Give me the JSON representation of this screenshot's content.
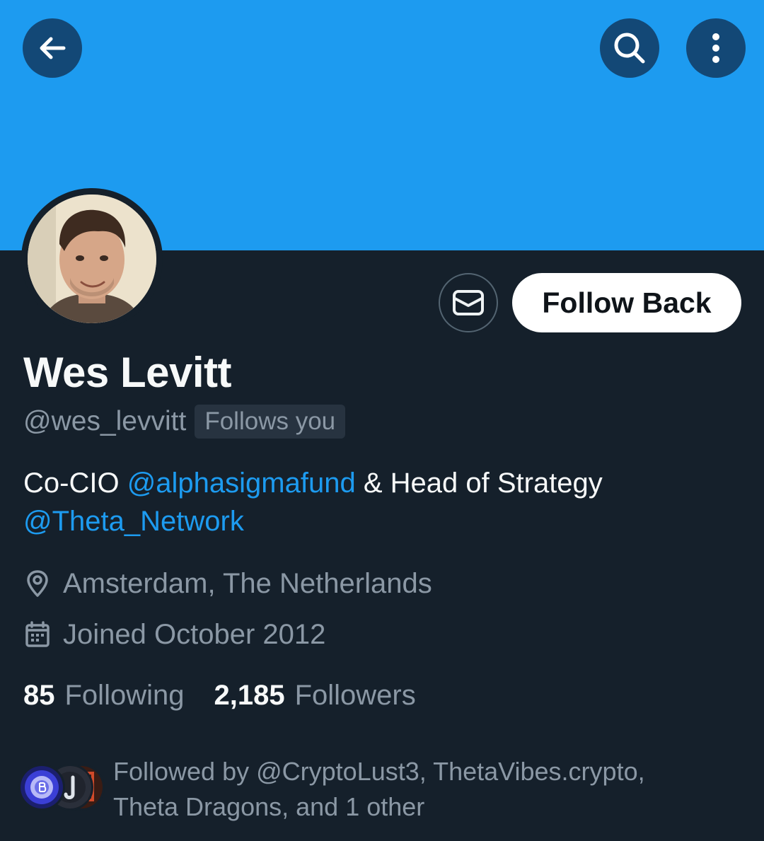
{
  "profile": {
    "display_name": "Wes Levitt",
    "handle": "@wes_levvitt",
    "follows_you_badge": "Follows you",
    "bio": {
      "part1": "Co-CIO ",
      "mention1": "@alphasigmafund",
      "part2": " & Head of Strategy",
      "mention2": "@Theta_Network"
    },
    "location": "Amsterdam, The Netherlands",
    "joined": "Joined October 2012"
  },
  "actions": {
    "follow_label": "Follow Back"
  },
  "stats": {
    "following_count": "85",
    "following_label": "Following",
    "followers_count": "2,185",
    "followers_label": "Followers"
  },
  "followed_by": {
    "text_line1": "Followed by @CryptoLust3, ThetaVibes.crypto,",
    "text_line2": "Theta Dragons, and 1 other"
  },
  "colors": {
    "banner": "#1d9bf0",
    "background": "#15202b",
    "accent": "#1d9bf0",
    "secondary_text": "#8b98a5"
  },
  "icons": {
    "back": "arrow-left-icon",
    "search": "search-icon",
    "more": "more-vertical-icon",
    "message": "mail-icon",
    "location": "location-pin-icon",
    "calendar": "calendar-icon"
  }
}
